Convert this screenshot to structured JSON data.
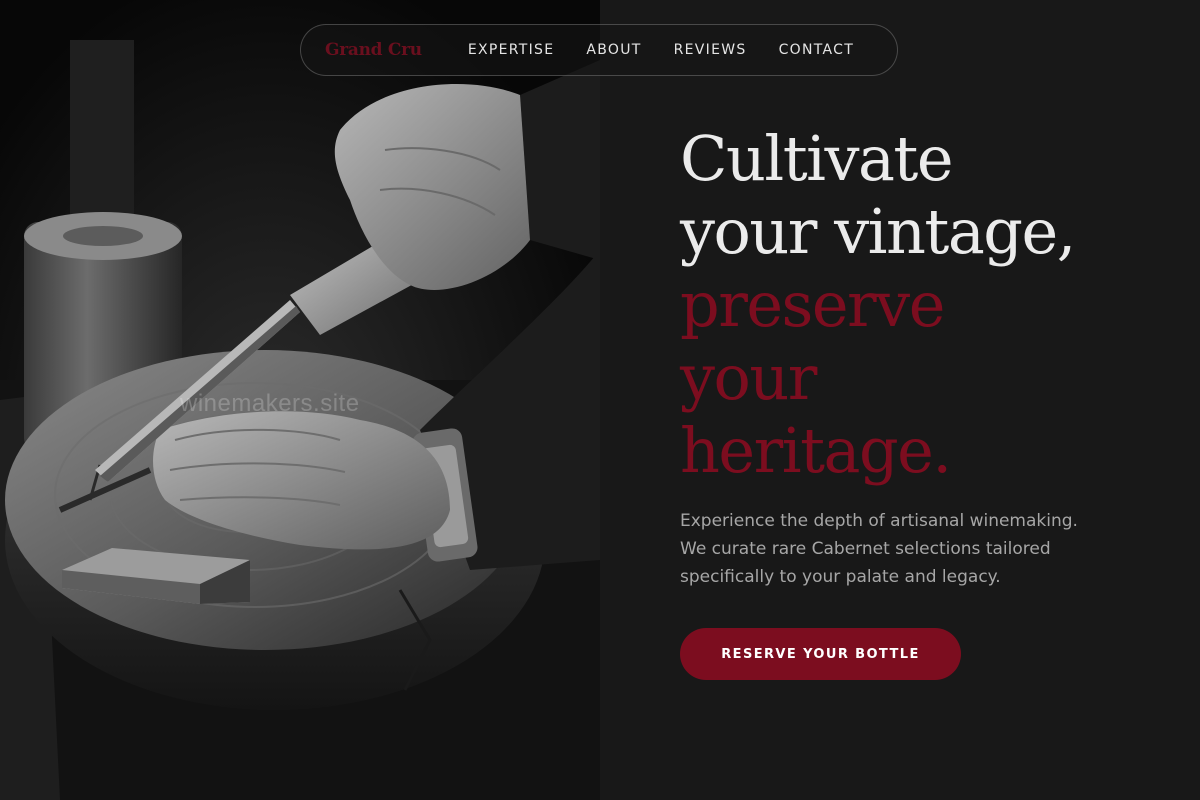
{
  "brand": {
    "name": "Grand Cru"
  },
  "nav": {
    "links": [
      {
        "label": "EXPERTISE"
      },
      {
        "label": "ABOUT"
      },
      {
        "label": "REVIEWS"
      },
      {
        "label": "CONTACT"
      }
    ]
  },
  "hero": {
    "headline_lines": [
      {
        "text": "Cultivate",
        "style": "light"
      },
      {
        "text": "your vintage,",
        "style": "light"
      },
      {
        "text": "preserve",
        "style": "accent"
      },
      {
        "text": "your",
        "style": "accent"
      },
      {
        "text": "heritage.",
        "style": "accent"
      }
    ],
    "description_lines": [
      "Experience the depth of artisanal winemaking.",
      "We curate rare Cabernet selections tailored",
      "specifically to your palate and legacy."
    ],
    "cta_label": "RESERVE YOUR BOTTLE",
    "image_watermark": "winemakers.site"
  },
  "colors": {
    "background": "#181818",
    "accent": "#7c0d1f",
    "headline_light": "#ebebeb",
    "body_text": "#a6a6a6"
  },
  "icons": {
    "photo": "woodcarving-photo"
  }
}
